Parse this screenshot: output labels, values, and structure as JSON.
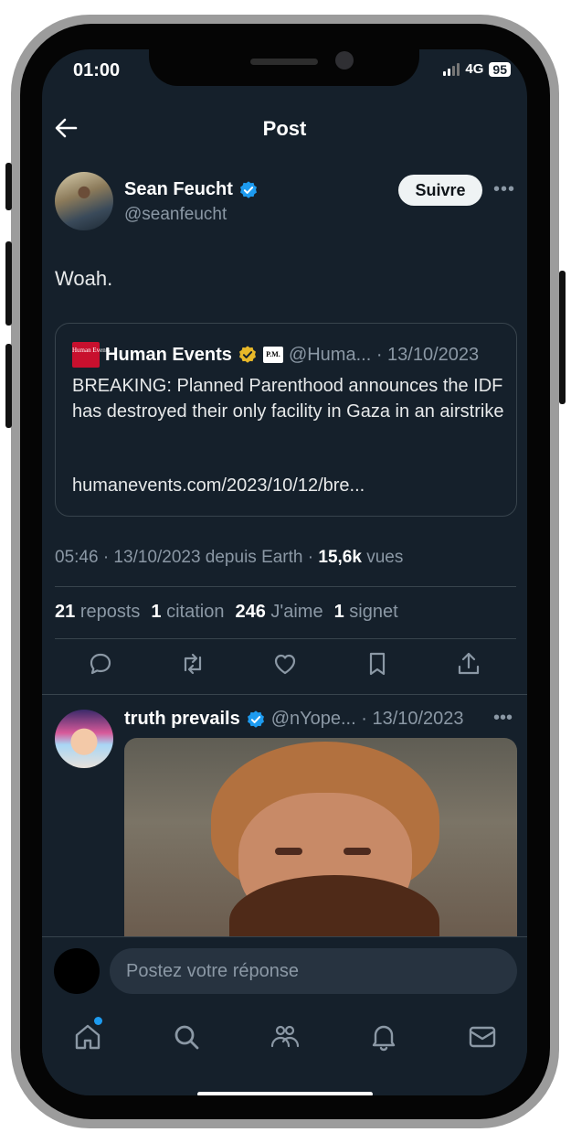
{
  "status_bar": {
    "time": "01:00",
    "network": "4G",
    "battery": "95"
  },
  "header": {
    "title": "Post"
  },
  "post": {
    "author_name": "Sean Feucht",
    "author_handle": "@seanfeucht",
    "follow_label": "Suivre",
    "text": "Woah.",
    "quote": {
      "logo_text": "Human Events",
      "name": "Human Events",
      "pm_badge": "P.M.",
      "handle_date": "@Huma... · 13/10/2023",
      "text": "BREAKING: Planned Parenthood announces the IDF has destroyed their only facility in Gaza in an airstrike",
      "link": "humanevents.com/2023/10/12/bre..."
    },
    "meta_prefix": "05:46 · 13/10/2023 depuis Earth · ",
    "views_count": "15,6k",
    "views_label": "vues",
    "stats": {
      "reposts_count": "21",
      "reposts_label": "reposts",
      "quotes_count": "1",
      "quotes_label": "citation",
      "likes_count": "246",
      "likes_label": "J'aime",
      "bookmarks_count": "1",
      "bookmarks_label": "signet"
    }
  },
  "reply": {
    "name": "truth prevails",
    "handle_date": "@nYope... · 13/10/2023"
  },
  "compose": {
    "placeholder": "Postez votre réponse"
  },
  "colors": {
    "background": "#15202b",
    "accent": "#1d9bf0",
    "muted": "#8b98a5",
    "divider": "#38444d"
  },
  "icons": [
    "back-arrow-icon",
    "verified-badge-icon",
    "more-icon",
    "reply-icon",
    "repost-icon",
    "like-icon",
    "bookmark-icon",
    "share-icon",
    "home-icon",
    "search-icon",
    "communities-icon",
    "notifications-icon",
    "messages-icon"
  ]
}
